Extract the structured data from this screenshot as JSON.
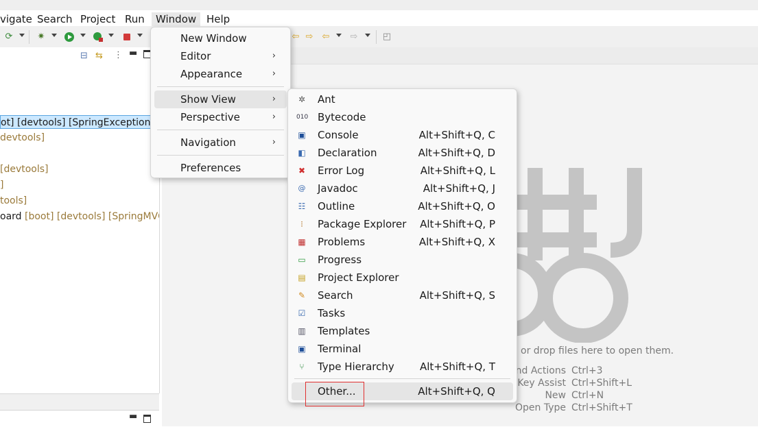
{
  "menubar": {
    "items": [
      "vigate",
      "Search",
      "Project",
      "Run",
      "Window",
      "Help"
    ]
  },
  "toolbar": {
    "icons": [
      "new-icon",
      "debug-icon",
      "run-icon",
      "coverage-icon",
      "stop-icon",
      "prev-edit-icon",
      "next-edit-icon",
      "back-icon",
      "forward-icon",
      "pin-icon"
    ]
  },
  "left_panel": {
    "rows": [
      {
        "name": "ot]",
        "tags": [
          "[devtools]",
          "[SpringExceptionH"
        ],
        "selected": true
      },
      {
        "name": "",
        "tags": [
          "devtools]"
        ]
      },
      {
        "name": "",
        "tags": []
      },
      {
        "name": "",
        "tags": [
          "[devtools]"
        ]
      },
      {
        "name": "",
        "tags": [
          "]"
        ]
      },
      {
        "name": "",
        "tags": [
          "tools]"
        ]
      },
      {
        "name": "oard",
        "tags": [
          "[boot]",
          "[devtools]",
          "[SpringMVC"
        ]
      }
    ]
  },
  "window_menu": {
    "items": [
      {
        "label": "New Window",
        "submenu": false
      },
      {
        "label": "Editor",
        "submenu": true
      },
      {
        "label": "Appearance",
        "submenu": true
      },
      {
        "label": "Show View",
        "submenu": true,
        "highlighted": true
      },
      {
        "label": "Perspective",
        "submenu": true
      },
      {
        "label": "Navigation",
        "submenu": true
      },
      {
        "label": "Preferences",
        "submenu": false
      }
    ],
    "arrow": "›"
  },
  "show_view_menu": {
    "items": [
      {
        "label": "Ant",
        "shortcut": "",
        "icon": "ant-icon"
      },
      {
        "label": "Bytecode",
        "shortcut": "",
        "icon": "bytecode-icon"
      },
      {
        "label": "Console",
        "shortcut": "Alt+Shift+Q, C",
        "icon": "console-icon"
      },
      {
        "label": "Declaration",
        "shortcut": "Alt+Shift+Q, D",
        "icon": "declaration-icon"
      },
      {
        "label": "Error Log",
        "shortcut": "Alt+Shift+Q, L",
        "icon": "error-log-icon"
      },
      {
        "label": "Javadoc",
        "shortcut": "Alt+Shift+Q, J",
        "icon": "javadoc-icon"
      },
      {
        "label": "Outline",
        "shortcut": "Alt+Shift+Q, O",
        "icon": "outline-icon"
      },
      {
        "label": "Package Explorer",
        "shortcut": "Alt+Shift+Q, P",
        "icon": "package-explorer-icon"
      },
      {
        "label": "Problems",
        "shortcut": "Alt+Shift+Q, X",
        "icon": "problems-icon"
      },
      {
        "label": "Progress",
        "shortcut": "",
        "icon": "progress-icon"
      },
      {
        "label": "Project Explorer",
        "shortcut": "",
        "icon": "project-explorer-icon"
      },
      {
        "label": "Search",
        "shortcut": "Alt+Shift+Q, S",
        "icon": "search-icon"
      },
      {
        "label": "Tasks",
        "shortcut": "",
        "icon": "tasks-icon"
      },
      {
        "label": "Templates",
        "shortcut": "",
        "icon": "templates-icon"
      },
      {
        "label": "Terminal",
        "shortcut": "",
        "icon": "terminal-icon"
      },
      {
        "label": "Type Hierarchy",
        "shortcut": "Alt+Shift+Q, T",
        "icon": "type-hierarchy-icon"
      }
    ],
    "other": {
      "label": "Other...",
      "shortcut": "Alt+Shift+Q, Q"
    }
  },
  "editor_hints": {
    "drop_text": "or drop files here to open them.",
    "shortcuts": [
      {
        "name": "nd Actions",
        "keys": "Ctrl+3"
      },
      {
        "name": "Key Assist",
        "keys": "Ctrl+Shift+L"
      },
      {
        "name": "New",
        "keys": "Ctrl+N"
      },
      {
        "name": "Open Type",
        "keys": "Ctrl+Shift+T"
      }
    ]
  },
  "colors": {
    "selection": "#cce8ff",
    "tag": "#9a7a3a",
    "highlight_box": "#e03030",
    "logo": "#c4c4c4"
  }
}
